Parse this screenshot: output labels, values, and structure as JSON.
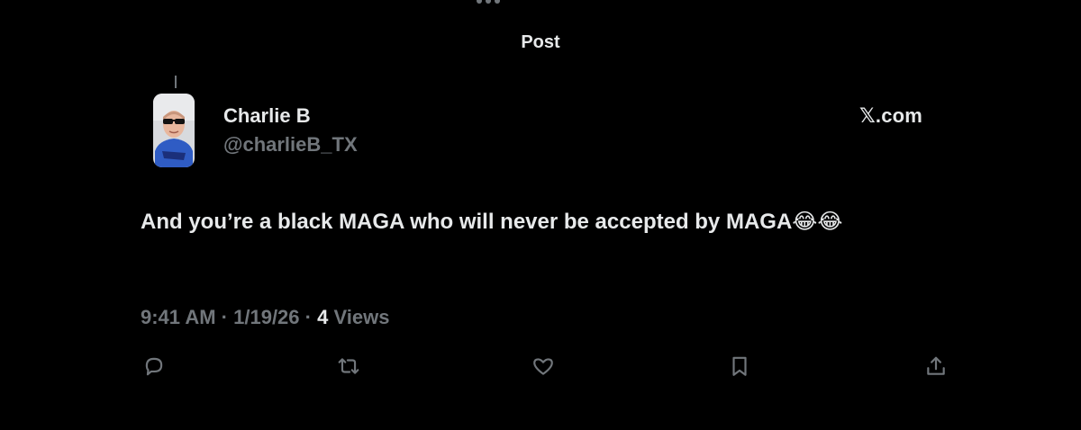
{
  "header": {
    "title": "Post"
  },
  "post": {
    "author": {
      "name": "Charlie B",
      "handle": "@charlieB_TX"
    },
    "brand": "𝕏.com",
    "text": "And you’re a black MAGA who will never be accepted by MAGA😂😂",
    "time": "9:41 AM",
    "date": "1/19/26",
    "separator": "·",
    "views_count": "4",
    "views_label": "Views"
  },
  "actions": [
    {
      "name": "reply",
      "icon": "reply-icon"
    },
    {
      "name": "repost",
      "icon": "repost-icon"
    },
    {
      "name": "like",
      "icon": "heart-icon"
    },
    {
      "name": "bookmark",
      "icon": "bookmark-icon"
    },
    {
      "name": "share",
      "icon": "share-icon"
    }
  ],
  "colors": {
    "background": "#000000",
    "primary_text": "#e7e9ea",
    "secondary_text": "#71767b"
  }
}
